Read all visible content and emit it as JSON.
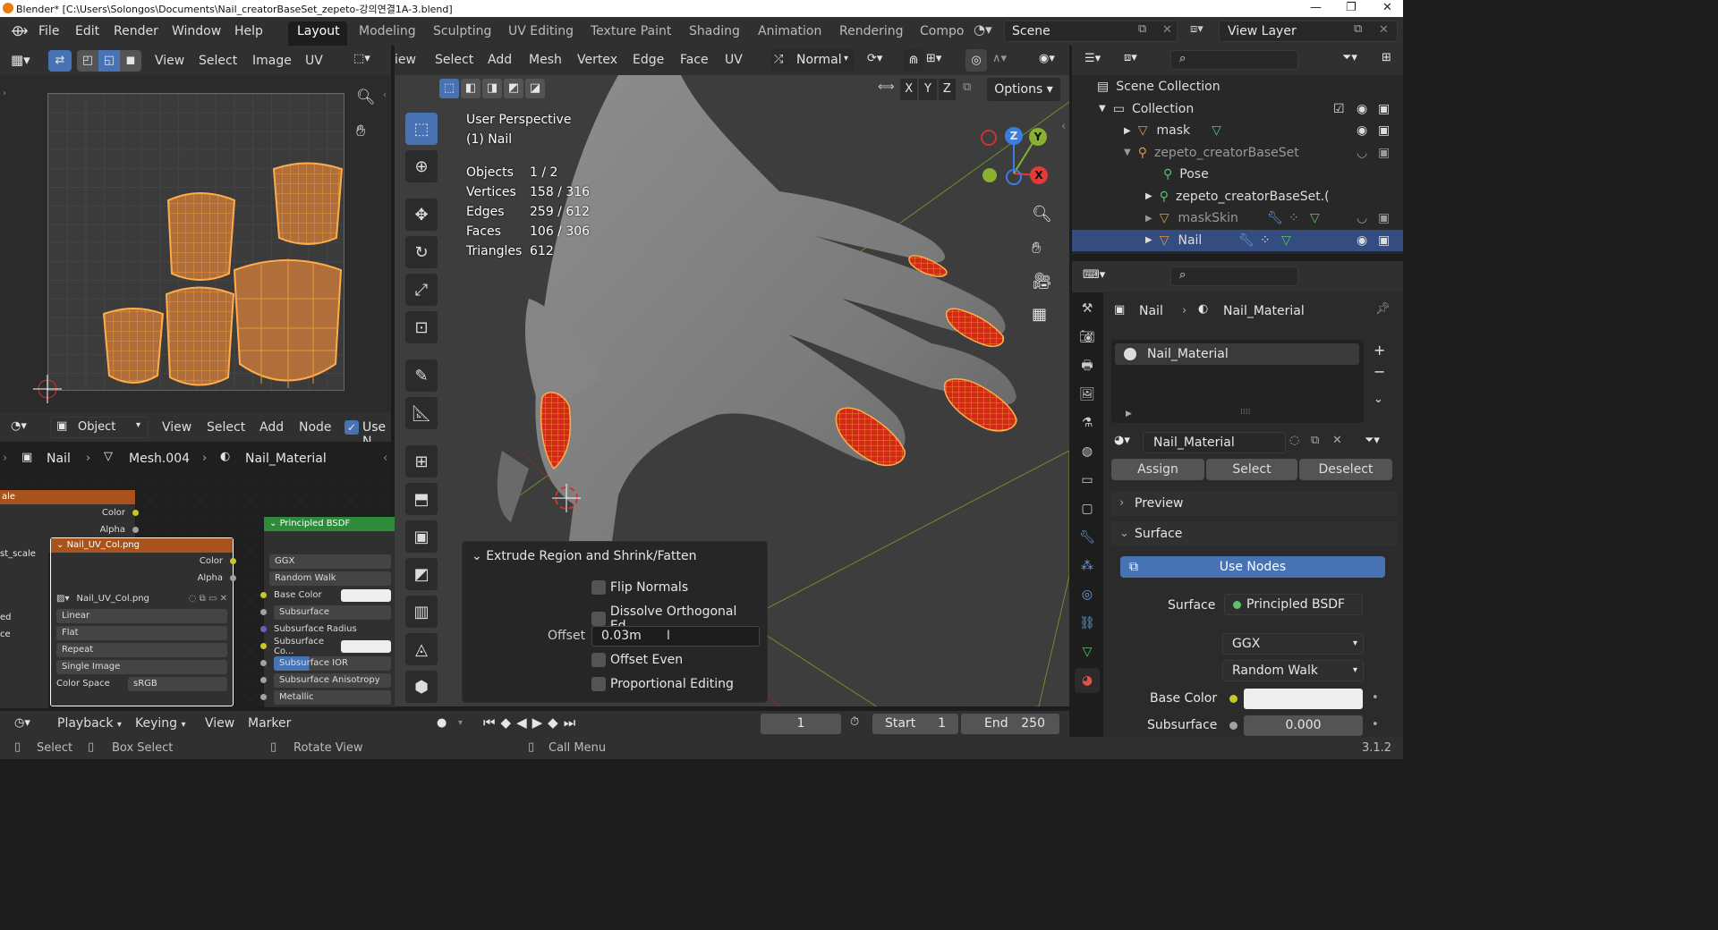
{
  "titlebar": {
    "title": "Blender* [C:\\Users\\Solongos\\Documents\\Nail_creatorBaseSet_zepeto-강의연결1A-3.blend]",
    "minimize": "—",
    "restore": "❐",
    "close": "✕"
  },
  "menu": {
    "file": "File",
    "edit": "Edit",
    "render": "Render",
    "window": "Window",
    "help": "Help"
  },
  "workspaces": [
    "Layout",
    "Modeling",
    "Sculpting",
    "UV Editing",
    "Texture Paint",
    "Shading",
    "Animation",
    "Rendering",
    "Compo"
  ],
  "scene": {
    "label": "Scene",
    "view_layer": "View Layer"
  },
  "uv_editor": {
    "menu": [
      "View",
      "Select",
      "Image",
      "UV"
    ]
  },
  "node_editor": {
    "object_mode": "Object",
    "menu": [
      "View",
      "Select",
      "Add",
      "Node"
    ],
    "use_nodes_short": "Use N",
    "breadcrumb": [
      "Nail",
      "Mesh.004",
      "Nail_Material"
    ],
    "scale_node": {
      "title": "ale",
      "out_color": "Color",
      "out_alpha": "Alpha",
      "left_label": "st_scale",
      "left2": "ed",
      "left3": "ce"
    },
    "image_node": {
      "title": "Nail_UV_Col.png",
      "out_color": "Color",
      "out_alpha": "Alpha",
      "image_name": "Nail_UV_Col.png",
      "interp": "Linear",
      "projection": "Flat",
      "extension": "Repeat",
      "source": "Single Image",
      "color_space_label": "Color Space",
      "color_space": "sRGB"
    },
    "bsdf_node": {
      "title": "Principled BSDF",
      "dist": "GGX",
      "sss": "Random Walk",
      "rows": [
        "Base Color",
        "Subsurface",
        "Subsurface Radius",
        "Subsurface Co...",
        "Subsurface IOR",
        "Subsurface Anisotropy",
        "Metallic"
      ]
    }
  },
  "viewport": {
    "menu": [
      "iew",
      "Select",
      "Add",
      "Mesh",
      "Vertex",
      "Edge",
      "Face",
      "UV"
    ],
    "orientation": "Normal",
    "options": "Options",
    "axes": [
      "X",
      "Y",
      "Z"
    ],
    "perspective": "User Perspective",
    "object_name": "(1) Nail",
    "stats": [
      {
        "label": "Objects",
        "value": "1 / 2"
      },
      {
        "label": "Vertices",
        "value": "158 / 316"
      },
      {
        "label": "Edges",
        "value": "259 / 612"
      },
      {
        "label": "Faces",
        "value": "106 / 306"
      },
      {
        "label": "Triangles",
        "value": "612"
      }
    ],
    "gizmo": {
      "z": "Z",
      "y": "Y",
      "x": "X"
    },
    "operator_panel": {
      "title": "Extrude Region and Shrink/Fatten",
      "flip_normals": "Flip Normals",
      "dissolve": "Dissolve Orthogonal Ed...",
      "offset_label": "Offset",
      "offset_value": "0.03m",
      "offset_even": "Offset Even",
      "proportional": "Proportional Editing"
    }
  },
  "outliner": {
    "rows": [
      {
        "label": "Scene Collection",
        "indent": 0
      },
      {
        "label": "Collection",
        "indent": 1
      },
      {
        "label": "mask",
        "indent": 2
      },
      {
        "label": "zepeto_creatorBaseSet",
        "indent": 2
      },
      {
        "label": "Pose",
        "indent": 3
      },
      {
        "label": "zepeto_creatorBaseSet.(",
        "indent": 3
      },
      {
        "label": "maskSkin",
        "indent": 2
      },
      {
        "label": "Nail",
        "indent": 2
      }
    ]
  },
  "properties": {
    "breadcrumb": [
      "Nail",
      "Nail_Material"
    ],
    "slot": "Nail_Material",
    "material_name": "Nail_Material",
    "assign": "Assign",
    "select": "Select",
    "deselect": "Deselect",
    "preview": "Preview",
    "surface_section": "Surface",
    "use_nodes": "Use Nodes",
    "surface_label": "Surface",
    "surface_value": "Principled BSDF",
    "distribution": "GGX",
    "subsurface_method": "Random Walk",
    "base_color_label": "Base Color",
    "subsurface_label": "Subsurface",
    "subsurface_value": "0.000"
  },
  "timeline": {
    "playback": "Playback",
    "keying": "Keying",
    "view": "View",
    "marker": "Marker",
    "current_frame": "1",
    "start_label": "Start",
    "start_value": "1",
    "end_label": "End",
    "end_value": "250"
  },
  "statusbar": {
    "select": "Select",
    "box_select": "Box Select",
    "rotate_view": "Rotate View",
    "call_menu": "Call Menu",
    "version": "3.1.2"
  },
  "colors": {
    "accent": "#4772b3",
    "header": "#303030",
    "panel": "#282828",
    "selection_orange": "#e8943a",
    "nail_red": "#d6281a"
  }
}
